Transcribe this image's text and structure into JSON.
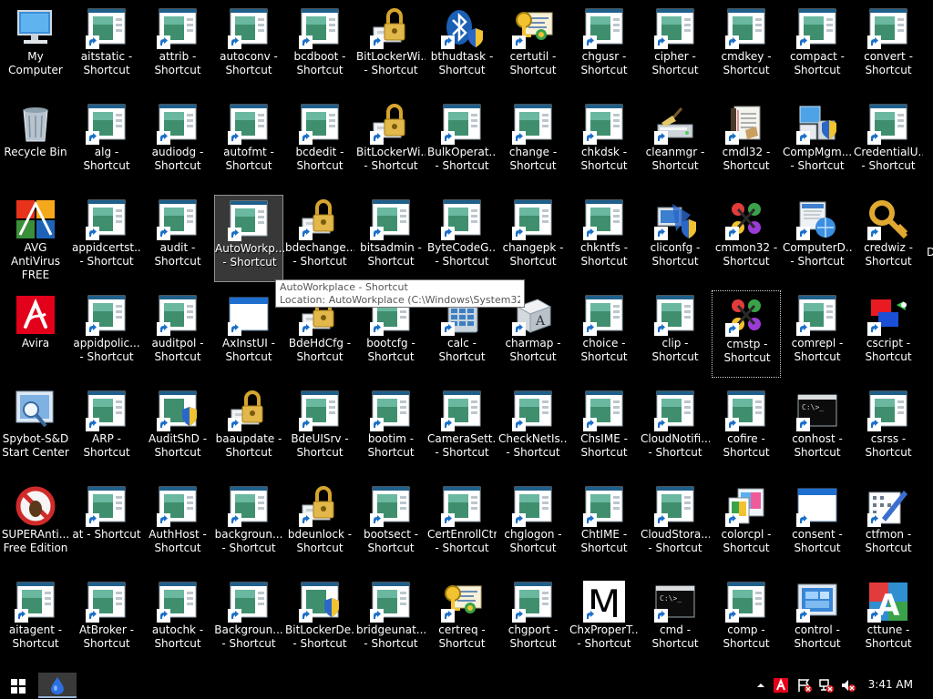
{
  "desktop": {
    "icons": [
      {
        "label": "My Computer",
        "type": "computer",
        "shortcut": false
      },
      {
        "label": "aitstatic -\nShortcut",
        "type": "app",
        "shortcut": true
      },
      {
        "label": "attrib -\nShortcut",
        "type": "app",
        "shortcut": true
      },
      {
        "label": "autoconv -\nShortcut",
        "type": "app",
        "shortcut": true
      },
      {
        "label": "bcdboot -\nShortcut",
        "type": "app",
        "shortcut": true
      },
      {
        "label": "BitLockerWi...\n- Shortcut",
        "type": "lock",
        "shortcut": true
      },
      {
        "label": "bthudtask -\nShortcut",
        "type": "bluetooth",
        "shortcut": true
      },
      {
        "label": "certutil -\nShortcut",
        "type": "cert",
        "shortcut": true
      },
      {
        "label": "chgusr -\nShortcut",
        "type": "app",
        "shortcut": true
      },
      {
        "label": "cipher -\nShortcut",
        "type": "app",
        "shortcut": true
      },
      {
        "label": "cmdkey -\nShortcut",
        "type": "app",
        "shortcut": true
      },
      {
        "label": "compact -\nShortcut",
        "type": "app",
        "shortcut": true
      },
      {
        "label": "convert -\nShortcut",
        "type": "app",
        "shortcut": true
      },
      {
        "label": "Recycle Bin",
        "type": "recycle",
        "shortcut": false
      },
      {
        "label": "alg - Shortcut",
        "type": "app",
        "shortcut": true
      },
      {
        "label": "audiodg -\nShortcut",
        "type": "app",
        "shortcut": true
      },
      {
        "label": "autofmt -\nShortcut",
        "type": "app",
        "shortcut": true
      },
      {
        "label": "bcdedit -\nShortcut",
        "type": "app",
        "shortcut": true
      },
      {
        "label": "BitLockerWi...\n- Shortcut",
        "type": "lock",
        "shortcut": true
      },
      {
        "label": "BulkOperat...\n- Shortcut",
        "type": "app",
        "shortcut": true
      },
      {
        "label": "change -\nShortcut",
        "type": "app",
        "shortcut": true
      },
      {
        "label": "chkdsk -\nShortcut",
        "type": "app",
        "shortcut": true
      },
      {
        "label": "cleanmgr -\nShortcut",
        "type": "cleanmgr",
        "shortcut": true
      },
      {
        "label": "cmdl32 -\nShortcut",
        "type": "notebook",
        "shortcut": true
      },
      {
        "label": "CompMgm...\n- Shortcut",
        "type": "compmgmt",
        "shortcut": true
      },
      {
        "label": "CredentialU...\n- Shortcut",
        "type": "app",
        "shortcut": true
      },
      {
        "label": "AVG AntiVirus\nFREE",
        "type": "avg",
        "shortcut": false
      },
      {
        "label": "appidcertst...\n- Shortcut",
        "type": "app",
        "shortcut": true
      },
      {
        "label": "audit -\nShortcut",
        "type": "app",
        "shortcut": true
      },
      {
        "label": "AutoWorkp...\n- Shortcut",
        "type": "app",
        "shortcut": true,
        "state": "selected"
      },
      {
        "label": "bdechange...\n- Shortcut",
        "type": "lock",
        "shortcut": true
      },
      {
        "label": "bitsadmin -\nShortcut",
        "type": "app",
        "shortcut": true
      },
      {
        "label": "ByteCodeG...\n- Shortcut",
        "type": "app",
        "shortcut": true
      },
      {
        "label": "changepk -\nShortcut",
        "type": "app",
        "shortcut": true
      },
      {
        "label": "chkntfs -\nShortcut",
        "type": "app",
        "shortcut": true
      },
      {
        "label": "cliconfg -\nShortcut",
        "type": "cliconfg",
        "shortcut": true
      },
      {
        "label": "cmmon32 -\nShortcut",
        "type": "cmmon",
        "shortcut": true
      },
      {
        "label": "ComputerD...\n- Shortcut",
        "type": "computerd",
        "shortcut": true
      },
      {
        "label": "credwiz -\nShortcut",
        "type": "key",
        "shortcut": true
      },
      {
        "label": "Avira",
        "type": "avira",
        "shortcut": false
      },
      {
        "label": "appidpolic...\n- Shortcut",
        "type": "app",
        "shortcut": true
      },
      {
        "label": "auditpol -\nShortcut",
        "type": "app",
        "shortcut": true
      },
      {
        "label": "AxInstUI -\nShortcut",
        "type": "window",
        "shortcut": true
      },
      {
        "label": "BdeHdCfg -\nShortcut",
        "type": "lock",
        "shortcut": true
      },
      {
        "label": "bootcfg -\nShortcut",
        "type": "app",
        "shortcut": true
      },
      {
        "label": "calc -\nShortcut",
        "type": "calc",
        "shortcut": true
      },
      {
        "label": "charmap -\nShortcut",
        "type": "charmap",
        "shortcut": true
      },
      {
        "label": "choice -\nShortcut",
        "type": "app",
        "shortcut": true
      },
      {
        "label": "clip -\nShortcut",
        "type": "app",
        "shortcut": true
      },
      {
        "label": "cmstp -\nShortcut",
        "type": "cmmon",
        "shortcut": true,
        "state": "focused"
      },
      {
        "label": "comrepl -\nShortcut",
        "type": "app",
        "shortcut": true
      },
      {
        "label": "cscript -\nShortcut",
        "type": "cscript",
        "shortcut": true
      },
      {
        "label": "Spybot-S&D\nStart Center",
        "type": "spybot",
        "shortcut": false
      },
      {
        "label": "ARP -\nShortcut",
        "type": "app",
        "shortcut": true
      },
      {
        "label": "AuditShD -\nShortcut",
        "type": "shield-app",
        "shortcut": true
      },
      {
        "label": "baaupdate -\nShortcut",
        "type": "lock",
        "shortcut": true
      },
      {
        "label": "BdeUISrv -\nShortcut",
        "type": "app",
        "shortcut": true
      },
      {
        "label": "bootim -\nShortcut",
        "type": "app",
        "shortcut": true
      },
      {
        "label": "CameraSett...\n- Shortcut",
        "type": "app",
        "shortcut": true
      },
      {
        "label": "CheckNetIs...\n- Shortcut",
        "type": "app",
        "shortcut": true
      },
      {
        "label": "ChsIME -\nShortcut",
        "type": "app",
        "shortcut": true
      },
      {
        "label": "CloudNotifi...\n- Shortcut",
        "type": "app",
        "shortcut": true
      },
      {
        "label": "cofire -\nShortcut",
        "type": "app",
        "shortcut": true
      },
      {
        "label": "conhost -\nShortcut",
        "type": "console",
        "shortcut": true
      },
      {
        "label": "csrss -\nShortcut",
        "type": "app",
        "shortcut": true
      },
      {
        "label": "SUPERAnti...\nFree Edition",
        "type": "superanti",
        "shortcut": false
      },
      {
        "label": "at - Shortcut",
        "type": "app",
        "shortcut": true
      },
      {
        "label": "AuthHost -\nShortcut",
        "type": "app",
        "shortcut": true
      },
      {
        "label": "backgroun...\n- Shortcut",
        "type": "app",
        "shortcut": true
      },
      {
        "label": "bdeunlock -\nShortcut",
        "type": "lock",
        "shortcut": true
      },
      {
        "label": "bootsect -\nShortcut",
        "type": "app",
        "shortcut": true
      },
      {
        "label": "CertEnrollCtrl\n- Shortcut",
        "type": "app",
        "shortcut": true
      },
      {
        "label": "chglogon -\nShortcut",
        "type": "app",
        "shortcut": true
      },
      {
        "label": "ChtIME -\nShortcut",
        "type": "app",
        "shortcut": true
      },
      {
        "label": "CloudStora...\n- Shortcut",
        "type": "app",
        "shortcut": true
      },
      {
        "label": "colorcpl -\nShortcut",
        "type": "colorcpl",
        "shortcut": true
      },
      {
        "label": "consent -\nShortcut",
        "type": "window",
        "shortcut": true
      },
      {
        "label": "ctfmon -\nShortcut",
        "type": "pen",
        "shortcut": true
      },
      {
        "label": "aitagent -\nShortcut",
        "type": "app",
        "shortcut": true
      },
      {
        "label": "AtBroker -\nShortcut",
        "type": "app",
        "shortcut": true
      },
      {
        "label": "autochk -\nShortcut",
        "type": "app",
        "shortcut": true
      },
      {
        "label": "Backgroun...\n- Shortcut",
        "type": "app",
        "shortcut": true
      },
      {
        "label": "BitLockerDe...\n- Shortcut",
        "type": "shield-app",
        "shortcut": true
      },
      {
        "label": "bridgeunat...\n- Shortcut",
        "type": "app",
        "shortcut": true
      },
      {
        "label": "certreq -\nShortcut",
        "type": "cert",
        "shortcut": true
      },
      {
        "label": "chgport -\nShortcut",
        "type": "app",
        "shortcut": true
      },
      {
        "label": "ChxProperT...\n- Shortcut",
        "type": "letter-m",
        "shortcut": true
      },
      {
        "label": "cmd -\nShortcut",
        "type": "console",
        "shortcut": true
      },
      {
        "label": "comp -\nShortcut",
        "type": "app",
        "shortcut": true
      },
      {
        "label": "control -\nShortcut",
        "type": "control",
        "shortcut": true
      },
      {
        "label": "cttune -\nShortcut",
        "type": "cttune",
        "shortcut": true
      }
    ]
  },
  "tooltip": {
    "title": "AutoWorkplace - Shortcut",
    "location": "Location: AutoWorkplace (C:\\Windows\\System32)"
  },
  "edge_partial": "D",
  "taskbar": {
    "clock": "3:41 AM"
  },
  "colors": {
    "desktop_bg": "#000000",
    "app_icon_frame": "#1f5f8b",
    "app_icon_green": "#3f8f6f",
    "shortcut_arrow": "#1a6fc9",
    "avira_red": "#e2001a"
  }
}
